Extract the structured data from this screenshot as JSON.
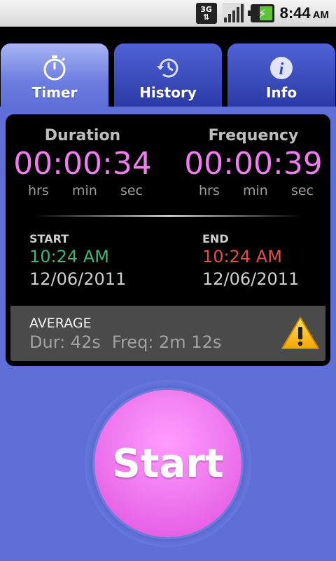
{
  "status": {
    "network": "3G",
    "time": "8:44",
    "ampm": "AM"
  },
  "tabs": [
    {
      "label": "Timer",
      "icon": "stopwatch-icon",
      "active": true
    },
    {
      "label": "History",
      "icon": "history-icon",
      "active": false
    },
    {
      "label": "Info",
      "icon": "info-icon",
      "active": false
    }
  ],
  "duration": {
    "heading": "Duration",
    "value": "00:00:34",
    "units": [
      "hrs",
      "min",
      "sec"
    ]
  },
  "frequency": {
    "heading": "Frequency",
    "value": "00:00:39",
    "units": [
      "hrs",
      "min",
      "sec"
    ]
  },
  "start": {
    "label": "START",
    "time": "10:24 AM",
    "date": "12/06/2011"
  },
  "end": {
    "label": "END",
    "time": "10:24 AM",
    "date": "12/06/2011"
  },
  "average": {
    "label": "AVERAGE",
    "duration": "Dur: 42s",
    "frequency": "Freq: 2m 12s",
    "icon": "warning-icon"
  },
  "start_button": {
    "label": "Start"
  },
  "colors": {
    "accent": "#f07cf0",
    "start_time": "#3cb878",
    "end_time": "#e14f4f",
    "background": "#5f6fd8"
  }
}
